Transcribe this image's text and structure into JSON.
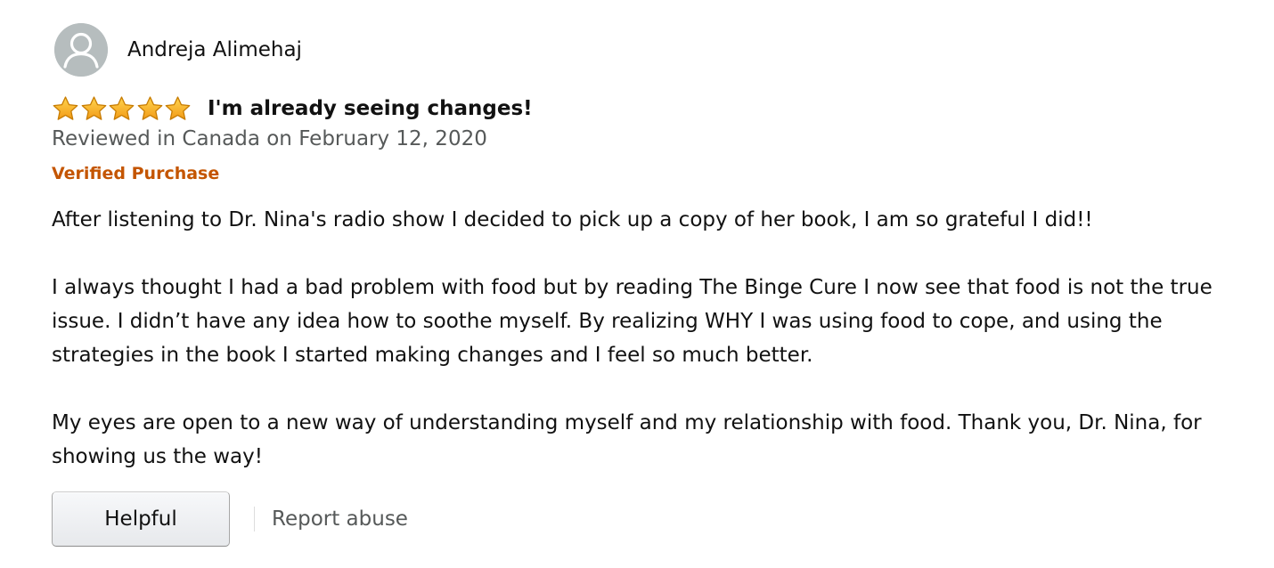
{
  "review": {
    "author": "Andreja Alimehaj",
    "avatar_icon": "default-user-avatar-icon",
    "rating": 5,
    "rating_max": 5,
    "star_color": "#f9a825",
    "title": "I'm already seeing changes!",
    "date_text": "Reviewed in Canada on February 12, 2020",
    "verified_label": "Verified Purchase",
    "verified_color": "#c45500",
    "body": [
      "After listening to Dr. Nina's radio show I decided to pick up a copy of her book, I am so grateful I did!!",
      "I always thought I had a bad problem with food but by reading The Binge Cure I now see that food is not the true issue. I didn’t have any idea how to soothe myself. By realizing WHY I was using food to cope, and using the strategies in the book I started making changes and I feel so much better.",
      "My eyes are open to a new way of understanding myself and my relationship with food. Thank you, Dr. Nina, for showing us the way!"
    ]
  },
  "actions": {
    "helpful_label": "Helpful",
    "report_label": "Report abuse"
  }
}
